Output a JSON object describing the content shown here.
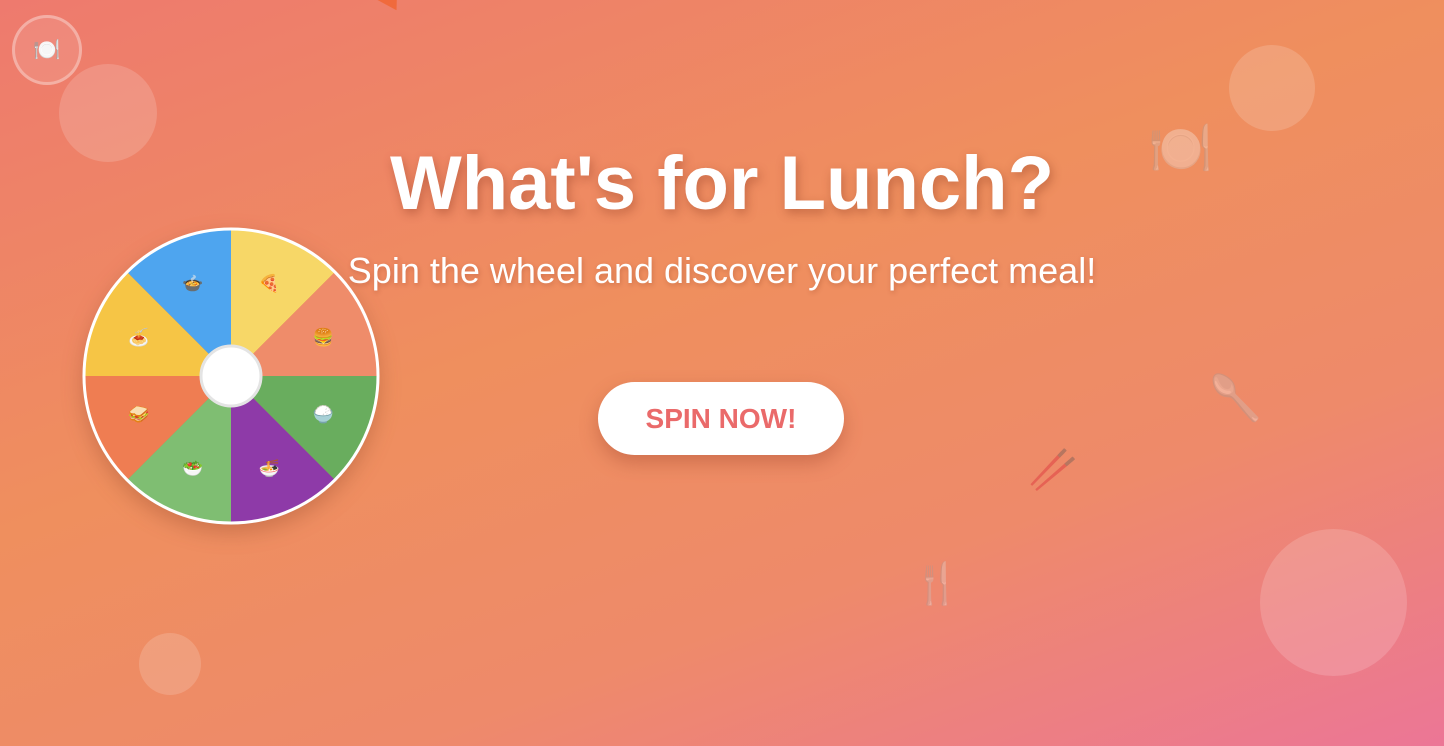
{
  "header": {
    "title": "What's for Lunch?",
    "subtitle": "Spin the wheel and discover your perfect meal!"
  },
  "actions": {
    "spin_label": "SPIN NOW!"
  },
  "logo": {
    "icon": "plate-with-cutlery-icon",
    "glyph": "🍽️"
  },
  "wheel": {
    "segments": [
      {
        "name": "pizza",
        "emoji": "🍕",
        "color": "#f7d767"
      },
      {
        "name": "burger",
        "emoji": "🍔",
        "color": "#ef8c6a"
      },
      {
        "name": "rice",
        "emoji": "🍚",
        "color": "#69ad5e"
      },
      {
        "name": "noodles",
        "emoji": "🍜",
        "color": "#8e3aa8"
      },
      {
        "name": "salad",
        "emoji": "🥗",
        "color": "#7fbe72"
      },
      {
        "name": "sandwich",
        "emoji": "🥪",
        "color": "#ef7d52"
      },
      {
        "name": "spaghetti",
        "emoji": "🍝",
        "color": "#f6c545"
      },
      {
        "name": "soup",
        "emoji": "🍲",
        "color": "#4ea5ef"
      }
    ]
  },
  "decorations": [
    {
      "icon": "plate-with-cutlery-icon",
      "glyph": "🍽️"
    },
    {
      "icon": "spoon-icon",
      "glyph": "🥄"
    },
    {
      "icon": "chopsticks-icon",
      "glyph": "🥢"
    },
    {
      "icon": "fork-and-knife-icon",
      "glyph": "🍴"
    }
  ]
}
